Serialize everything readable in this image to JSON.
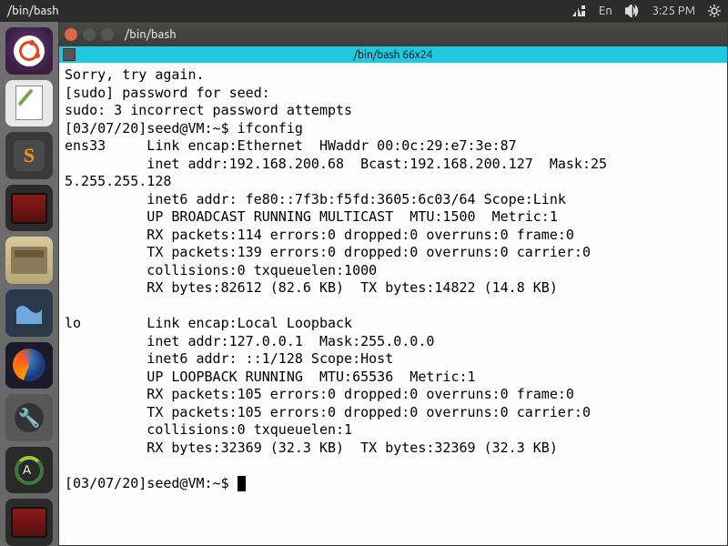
{
  "topbar": {
    "title": "/bin/bash",
    "lang": "En",
    "time": "3:25 PM"
  },
  "launcher": {
    "sublime_letter": "S",
    "update_letter": "A",
    "wrench": "🔧"
  },
  "term": {
    "window_title": "/bin/bash",
    "tab_label": "/bin/bash 66x24",
    "lines": {
      "l0": "Sorry, try again.",
      "l1": "[sudo] password for seed:",
      "l2": "sudo: 3 incorrect password attempts",
      "l3": "[03/07/20]seed@VM:~$ ifconfig",
      "l4": "ens33     Link encap:Ethernet  HWaddr 00:0c:29:e7:3e:87",
      "l5": "          inet addr:192.168.200.68  Bcast:192.168.200.127  Mask:25",
      "l6": "5.255.255.128",
      "l7": "          inet6 addr: fe80::7f3b:f5fd:3605:6c03/64 Scope:Link",
      "l8": "          UP BROADCAST RUNNING MULTICAST  MTU:1500  Metric:1",
      "l9": "          RX packets:114 errors:0 dropped:0 overruns:0 frame:0",
      "l10": "          TX packets:139 errors:0 dropped:0 overruns:0 carrier:0",
      "l11": "          collisions:0 txqueuelen:1000",
      "l12": "          RX bytes:82612 (82.6 KB)  TX bytes:14822 (14.8 KB)",
      "l13": "",
      "l14": "lo        Link encap:Local Loopback",
      "l15": "          inet addr:127.0.0.1  Mask:255.0.0.0",
      "l16": "          inet6 addr: ::1/128 Scope:Host",
      "l17": "          UP LOOPBACK RUNNING  MTU:65536  Metric:1",
      "l18": "          RX packets:105 errors:0 dropped:0 overruns:0 frame:0",
      "l19": "          TX packets:105 errors:0 dropped:0 overruns:0 carrier:0",
      "l20": "          collisions:0 txqueuelen:1",
      "l21": "          RX bytes:32369 (32.3 KB)  TX bytes:32369 (32.3 KB)",
      "l22": "",
      "l23": "[03/07/20]seed@VM:~$ "
    }
  }
}
